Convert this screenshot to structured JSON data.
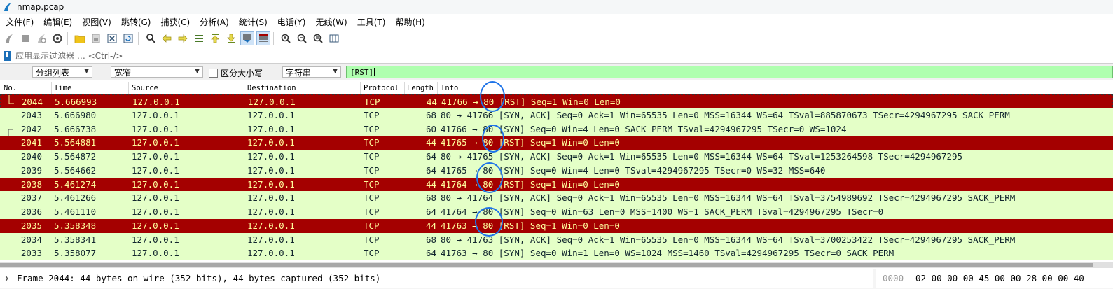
{
  "window": {
    "title": "nmap.pcap"
  },
  "menu": [
    "文件(F)",
    "编辑(E)",
    "视图(V)",
    "跳转(G)",
    "捕获(C)",
    "分析(A)",
    "统计(S)",
    "电话(Y)",
    "无线(W)",
    "工具(T)",
    "帮助(H)"
  ],
  "filter": {
    "placeholder": "应用显示过滤器 … <Ctrl-/>"
  },
  "find": {
    "scope": "分组列表",
    "encoding": "宽窄",
    "case_label": "区分大小写",
    "type": "字符串",
    "query": "[RST]"
  },
  "columns": [
    "No.",
    "Time",
    "Source",
    "Destination",
    "Protocol",
    "Length",
    "Info"
  ],
  "packets": [
    {
      "no": "2044",
      "time": "5.666993",
      "src": "127.0.0.1",
      "dst": "127.0.0.1",
      "proto": "TCP",
      "len": "44",
      "info": "41766 → 80 [RST] Seq=1 Win=0 Len=0",
      "kind": "rst"
    },
    {
      "no": "2043",
      "time": "5.666980",
      "src": "127.0.0.1",
      "dst": "127.0.0.1",
      "proto": "TCP",
      "len": "68",
      "info": "80 → 41766 [SYN, ACK] Seq=0 Ack=1 Win=65535 Len=0 MSS=16344 WS=64 TSval=885870673 TSecr=4294967295 SACK_PERM",
      "kind": "syn"
    },
    {
      "no": "2042",
      "time": "5.666738",
      "src": "127.0.0.1",
      "dst": "127.0.0.1",
      "proto": "TCP",
      "len": "60",
      "info": "41766 → 80 [SYN] Seq=0 Win=4 Len=0 SACK_PERM TSval=4294967295 TSecr=0 WS=1024",
      "kind": "syn"
    },
    {
      "no": "2041",
      "time": "5.564881",
      "src": "127.0.0.1",
      "dst": "127.0.0.1",
      "proto": "TCP",
      "len": "44",
      "info": "41765 → 80 [RST] Seq=1 Win=0 Len=0",
      "kind": "rst"
    },
    {
      "no": "2040",
      "time": "5.564872",
      "src": "127.0.0.1",
      "dst": "127.0.0.1",
      "proto": "TCP",
      "len": "64",
      "info": "80 → 41765 [SYN, ACK] Seq=0 Ack=1 Win=65535 Len=0 MSS=16344 WS=64 TSval=1253264598 TSecr=4294967295",
      "kind": "syn"
    },
    {
      "no": "2039",
      "time": "5.564662",
      "src": "127.0.0.1",
      "dst": "127.0.0.1",
      "proto": "TCP",
      "len": "64",
      "info": "41765 → 80 [SYN] Seq=0 Win=4 Len=0 TSval=4294967295 TSecr=0 WS=32 MSS=640",
      "kind": "syn"
    },
    {
      "no": "2038",
      "time": "5.461274",
      "src": "127.0.0.1",
      "dst": "127.0.0.1",
      "proto": "TCP",
      "len": "44",
      "info": "41764 → 80 [RST] Seq=1 Win=0 Len=0",
      "kind": "rst"
    },
    {
      "no": "2037",
      "time": "5.461266",
      "src": "127.0.0.1",
      "dst": "127.0.0.1",
      "proto": "TCP",
      "len": "68",
      "info": "80 → 41764 [SYN, ACK] Seq=0 Ack=1 Win=65535 Len=0 MSS=16344 WS=64 TSval=3754989692 TSecr=4294967295 SACK_PERM",
      "kind": "syn"
    },
    {
      "no": "2036",
      "time": "5.461110",
      "src": "127.0.0.1",
      "dst": "127.0.0.1",
      "proto": "TCP",
      "len": "64",
      "info": "41764 → 80 [SYN] Seq=0 Win=63 Len=0 MSS=1400 WS=1 SACK_PERM TSval=4294967295 TSecr=0",
      "kind": "syn"
    },
    {
      "no": "2035",
      "time": "5.358348",
      "src": "127.0.0.1",
      "dst": "127.0.0.1",
      "proto": "TCP",
      "len": "44",
      "info": "41763 → 80 [RST] Seq=1 Win=0 Len=0",
      "kind": "rst"
    },
    {
      "no": "2034",
      "time": "5.358341",
      "src": "127.0.0.1",
      "dst": "127.0.0.1",
      "proto": "TCP",
      "len": "68",
      "info": "80 → 41763 [SYN, ACK] Seq=0 Ack=1 Win=65535 Len=0 MSS=16344 WS=64 TSval=3700253422 TSecr=4294967295 SACK_PERM",
      "kind": "syn"
    },
    {
      "no": "2033",
      "time": "5.358077",
      "src": "127.0.0.1",
      "dst": "127.0.0.1",
      "proto": "TCP",
      "len": "64",
      "info": "41763 → 80 [SYN] Seq=0 Win=1 Len=0 WS=1024 MSS=1460 TSval=4294967295 TSecr=0 SACK_PERM",
      "kind": "syn"
    }
  ],
  "status": {
    "frame_summary": "Frame 2044: 44 bytes on wire (352 bits), 44 bytes captured (352 bits)",
    "hex_offset": "0000",
    "hex_bytes": "02 00 00 00 45 00 00 28  00 00 40"
  },
  "colors": {
    "rst_bg": "#a40000",
    "rst_fg": "#fffc9c",
    "syn_bg": "#e4ffc7",
    "find_bg": "#afffaf",
    "annotation": "#1e73e8"
  },
  "icons": [
    "start-capture-icon",
    "stop-capture-icon",
    "restart-capture-icon",
    "capture-options-icon",
    "open-file-icon",
    "save-file-icon",
    "close-file-icon",
    "reload-icon",
    "find-packet-icon",
    "go-back-icon",
    "go-forward-icon",
    "go-to-packet-icon",
    "go-first-icon",
    "go-last-icon",
    "autoscroll-icon",
    "colorize-icon",
    "zoom-in-icon",
    "zoom-out-icon",
    "zoom-normal-icon",
    "resize-columns-icon"
  ]
}
